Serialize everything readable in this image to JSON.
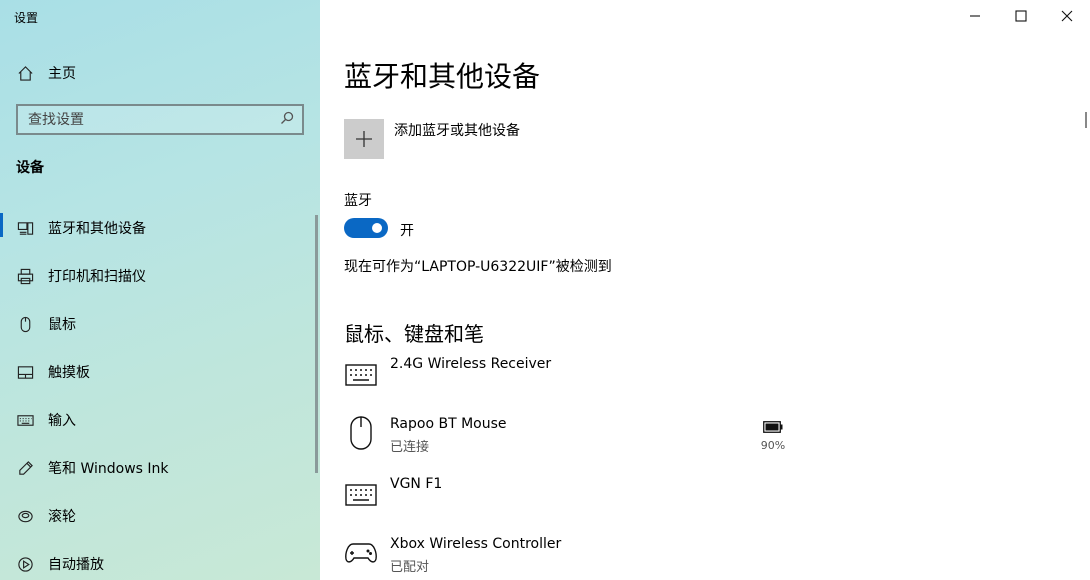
{
  "window": {
    "title": "设置",
    "controls": [
      "minimize",
      "maximize",
      "close"
    ]
  },
  "sidebar": {
    "home_label": "主页",
    "search_placeholder": "查找设置",
    "section_title": "设备",
    "items": [
      {
        "label": "蓝牙和其他设备",
        "icon": "bluetooth-devices-icon",
        "selected": true
      },
      {
        "label": "打印机和扫描仪",
        "icon": "printer-icon"
      },
      {
        "label": "鼠标",
        "icon": "mouse-icon"
      },
      {
        "label": "触摸板",
        "icon": "touchpad-icon"
      },
      {
        "label": "输入",
        "icon": "keyboard-icon"
      },
      {
        "label": "笔和 Windows Ink",
        "icon": "pen-icon"
      },
      {
        "label": "滚轮",
        "icon": "wheel-icon"
      },
      {
        "label": "自动播放",
        "icon": "autoplay-icon"
      }
    ]
  },
  "main": {
    "title": "蓝牙和其他设备",
    "add_device_label": "添加蓝牙或其他设备",
    "bluetooth": {
      "heading": "蓝牙",
      "toggle_state": "开",
      "discoverable_text": "现在可作为“LAPTOP-U6322UIF”被检测到"
    },
    "mouse_keyboard_pen": {
      "heading": "鼠标、键盘和笔",
      "devices": [
        {
          "name": "2.4G Wireless Receiver",
          "status": "",
          "icon": "keyboard-icon"
        },
        {
          "name": "Rapoo BT Mouse",
          "status": "已连接",
          "icon": "mouse-icon",
          "battery": "90%"
        },
        {
          "name": "VGN F1",
          "status": "",
          "icon": "keyboard-icon"
        },
        {
          "name": "Xbox Wireless Controller",
          "status": "已配对",
          "icon": "gamepad-icon"
        }
      ]
    }
  },
  "colors": {
    "accent": "#0a68c4",
    "sidebar_bg": "#b6e4e4"
  }
}
